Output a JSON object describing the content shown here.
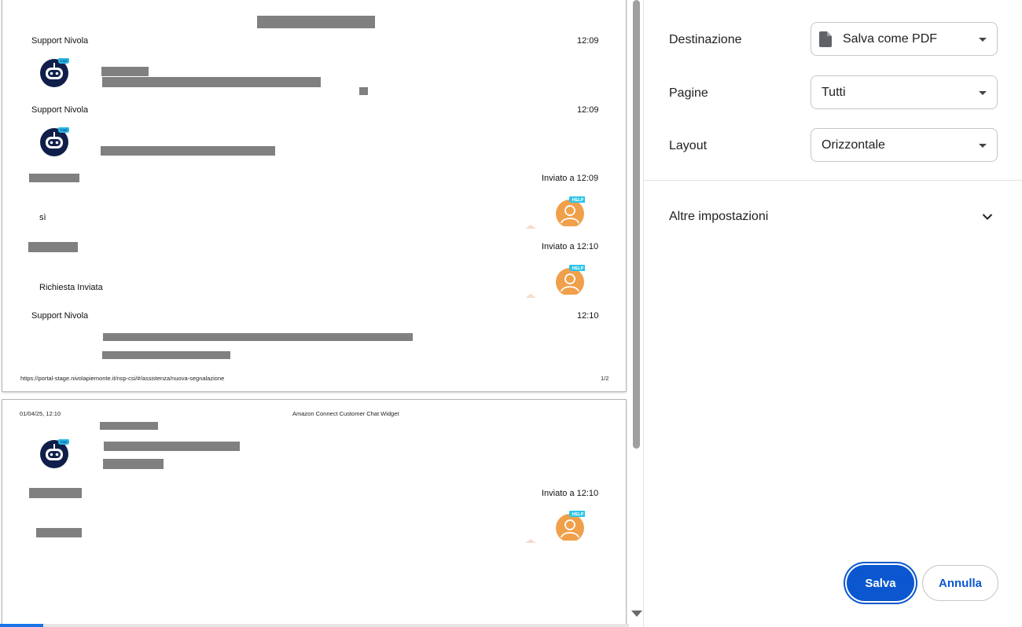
{
  "preview": {
    "page1": {
      "messages": [
        {
          "sender": "Support Nivola",
          "time": "12:09"
        },
        {
          "sender": "Support Nivola",
          "time": "12:09"
        },
        {
          "sent_label": "Inviato a  12:09",
          "text": "sì"
        },
        {
          "sent_label": "Inviato a  12:10",
          "text": "Richiesta Inviata"
        },
        {
          "sender": "Support Nivola",
          "time": "12:10"
        }
      ],
      "footer_url": "https://portal-stage.nivolapiemonte.it/nsp-csi/#/assistenza/nuova-segnalazione",
      "footer_page": "1/2"
    },
    "page2": {
      "header_date": "01/04/25, 12:10",
      "header_title": "Amazon Connect Customer Chat Widget",
      "messages": [
        {
          "sent_label": "Inviato a  12:10"
        }
      ]
    },
    "avatar_badge_bot": "Csel",
    "avatar_badge_user": "HELP"
  },
  "settings": {
    "destination": {
      "label": "Destinazione",
      "value": "Salva come PDF"
    },
    "pages": {
      "label": "Pagine",
      "value": "Tutti"
    },
    "layout": {
      "label": "Layout",
      "value": "Orizzontale"
    },
    "more_settings": "Altre impostazioni",
    "save_label": "Salva",
    "cancel_label": "Annulla",
    "accent_color": "#0b57d0"
  }
}
